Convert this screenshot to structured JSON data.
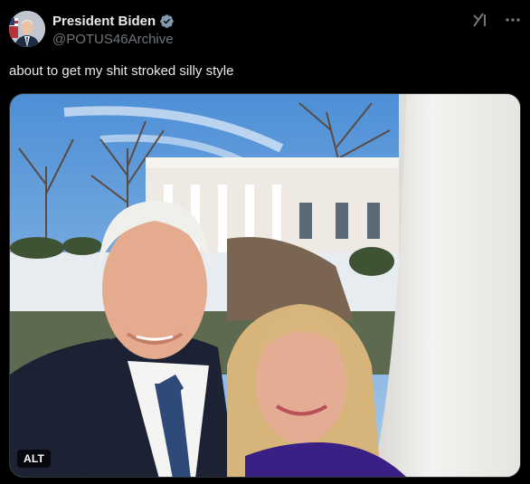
{
  "post": {
    "author_name": "President Biden",
    "author_handle": "@POTUS46Archive",
    "text": "about to get my shit stroked silly style"
  },
  "media": {
    "alt_label": "ALT"
  },
  "icons": {
    "verified": "verified-badge-icon",
    "grok": "grok-icon",
    "more": "more-icon"
  },
  "colors": {
    "background": "#000000",
    "primary_text": "#e7e9ea",
    "secondary_text": "#71767b",
    "verified_badge": "#829aab"
  }
}
